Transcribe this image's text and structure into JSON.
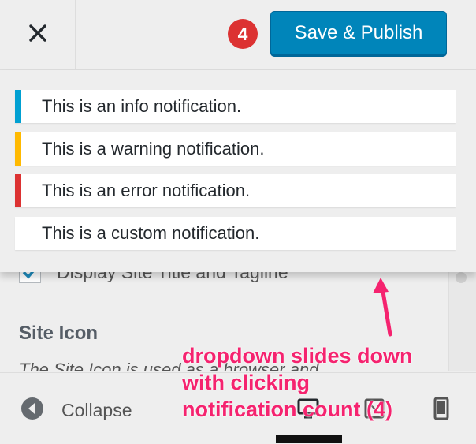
{
  "header": {
    "close_icon": "close-icon",
    "notification_count": "4",
    "publish_label": "Save & Publish"
  },
  "notifications": [
    {
      "text": "This is an info notification.",
      "type": "info",
      "color": "#00a0d2"
    },
    {
      "text": "This is a warning notification.",
      "type": "warning",
      "color": "#ffb900"
    },
    {
      "text": "This is an error notification.",
      "type": "error",
      "color": "#dc3232"
    },
    {
      "text": "This is a custom notification.",
      "type": "custom",
      "color": "#ffffff"
    }
  ],
  "content": {
    "checkbox_label": "Display Site Title and Tagline",
    "checkbox_checked": true,
    "section_title": "Site Icon",
    "description": "The Site Icon is used as a browser and"
  },
  "footer": {
    "collapse_label": "Collapse",
    "devices": [
      "desktop-icon",
      "tablet-icon",
      "mobile-icon"
    ]
  },
  "annotation": {
    "text": "dropdown slides down\nwith clicking\nnotification count (4)",
    "color": "#f5236f"
  },
  "colors": {
    "primary": "#0085ba",
    "badge": "#dc3232"
  }
}
